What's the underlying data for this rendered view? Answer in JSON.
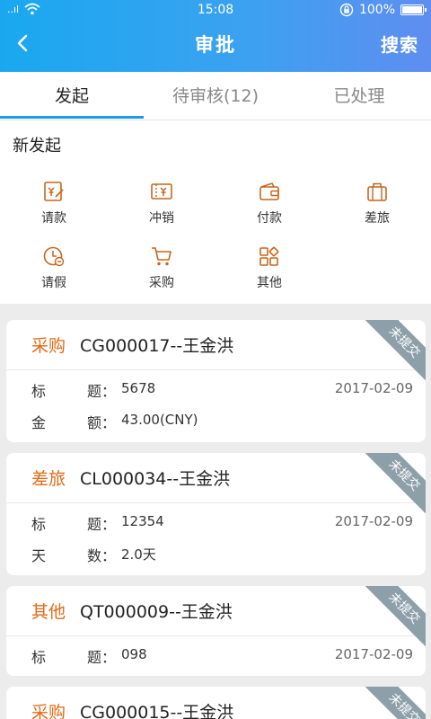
{
  "status": {
    "signal": "..ıl",
    "time": "15:08",
    "battery": "100%"
  },
  "nav": {
    "title": "审批",
    "search": "搜索"
  },
  "tabs": [
    {
      "label": "发起"
    },
    {
      "label": "待审核(12)"
    },
    {
      "label": "已处理"
    }
  ],
  "new_section": {
    "title": "新发起",
    "items": [
      {
        "label": "请款",
        "icon": "request-money-icon"
      },
      {
        "label": "冲销",
        "icon": "writeoff-icon"
      },
      {
        "label": "付款",
        "icon": "wallet-icon"
      },
      {
        "label": "差旅",
        "icon": "suitcase-icon"
      },
      {
        "label": "请假",
        "icon": "clock-icon"
      },
      {
        "label": "采购",
        "icon": "cart-icon"
      },
      {
        "label": "其他",
        "icon": "apps-icon"
      }
    ]
  },
  "cards": [
    {
      "type": "采购",
      "code": "CG000017--王金洪",
      "badge": "未提交",
      "rows": [
        {
          "k1": "标",
          "k2": "题：",
          "value": "5678",
          "date": "2017-02-09"
        },
        {
          "k1": "金",
          "k2": "额：",
          "value": "43.00(CNY)",
          "date": ""
        }
      ]
    },
    {
      "type": "差旅",
      "code": "CL000034--王金洪",
      "badge": "未提交",
      "rows": [
        {
          "k1": "标",
          "k2": "题：",
          "value": "12354",
          "date": "2017-02-09"
        },
        {
          "k1": "天",
          "k2": "数：",
          "value": "2.0天",
          "date": ""
        }
      ]
    },
    {
      "type": "其他",
      "code": "QT000009--王金洪",
      "badge": "未提交",
      "rows": [
        {
          "k1": "标",
          "k2": "题：",
          "value": "098",
          "date": "2017-02-09"
        }
      ]
    },
    {
      "type": "采购",
      "code": "CG000015--王金洪",
      "badge": "未提交",
      "rows": []
    }
  ],
  "colors": {
    "header_start": "#19a8ef",
    "header_end": "#5f8ef0",
    "accent_orange": "#e06a16",
    "tab_indicator": "#1a9de8",
    "badge": "#8d9fa9"
  }
}
